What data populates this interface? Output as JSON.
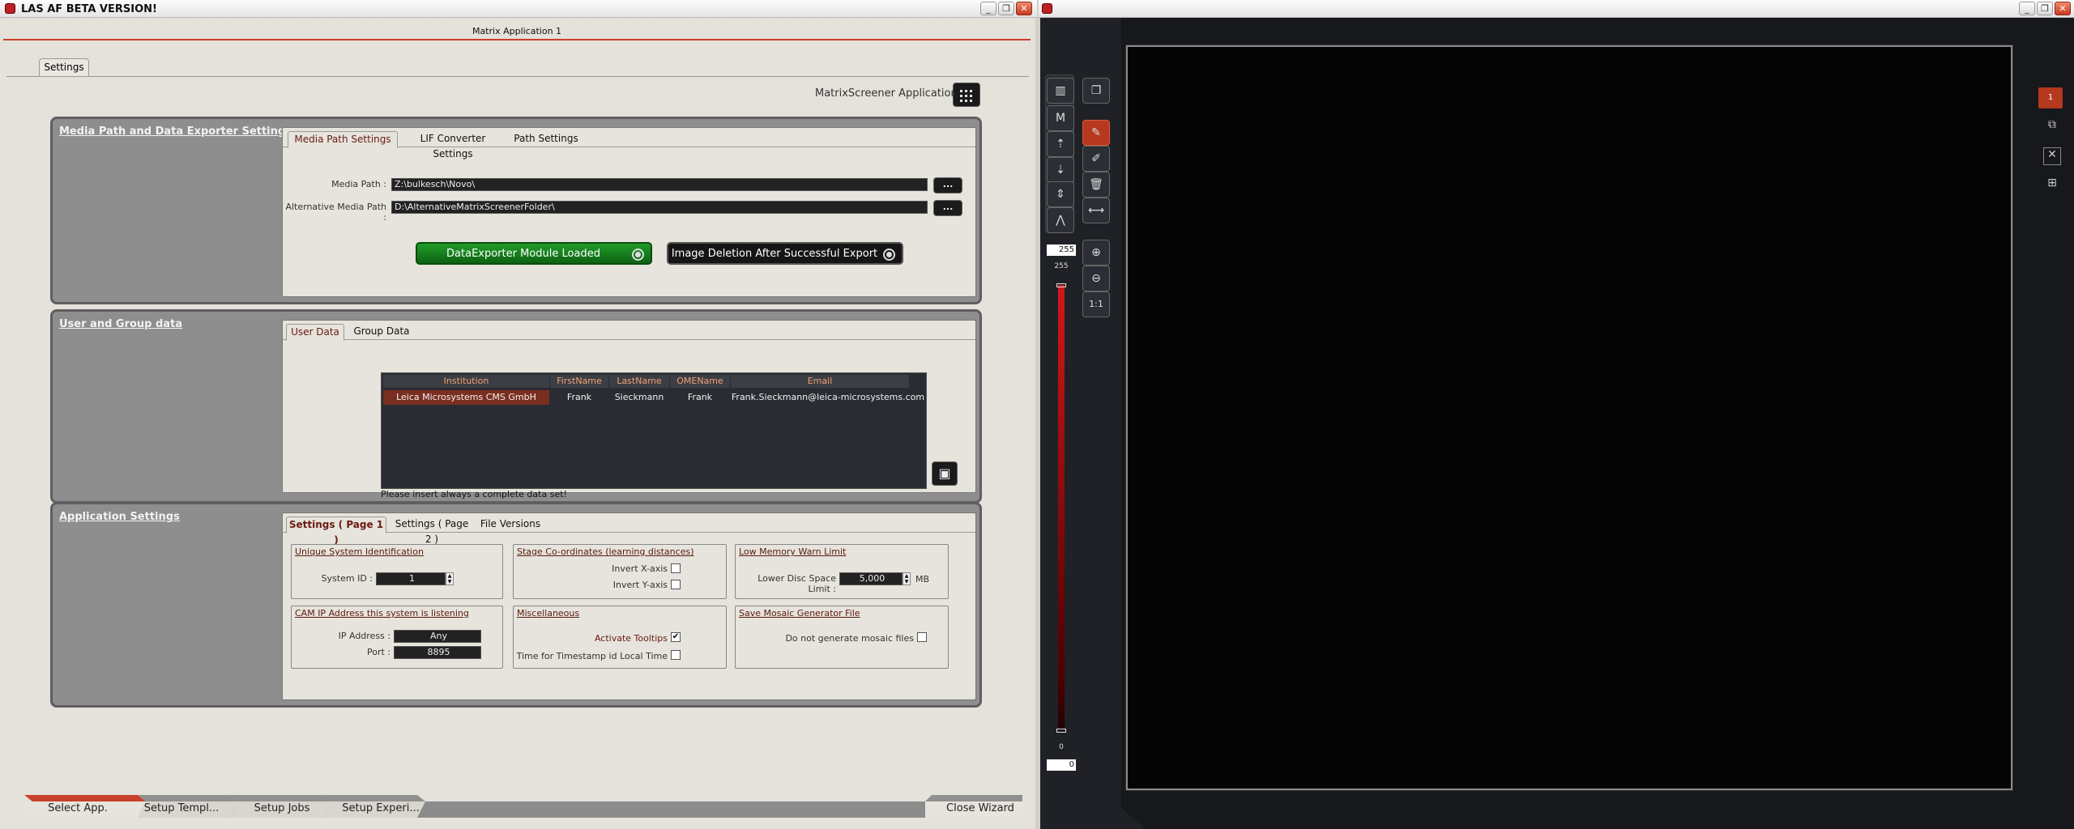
{
  "left_window": {
    "title": "LAS AF BETA VERSION!",
    "matrix_title": "Matrix Application 1",
    "outer_tab": "Settings",
    "matrixscreener_label": "MatrixScreener Applications"
  },
  "media": {
    "title": "Media Path and Data Exporter Settings",
    "tabs": [
      "Media Path Settings",
      "LIF Converter Settings",
      "Path Settings"
    ],
    "media_path_label": "Media Path",
    "media_path_value": "Z:\\bulkesch\\Novo\\",
    "alt_path_label": "Alternative Media Path",
    "alt_path_value": "D:\\AlternativeMatrixScreenerFolder\\",
    "browse": "...",
    "exporter_button": "DataExporter Module Loaded",
    "deletion_button": "Image Deletion After Successful Export"
  },
  "user": {
    "title": "User and Group data",
    "tabs": [
      "User Data",
      "Group Data"
    ],
    "columns": [
      "Institution",
      "FirstName",
      "LastName",
      "OMEName",
      "Email"
    ],
    "rows": [
      [
        "Leica Microsystems CMS GmbH",
        "Frank",
        "Sieckmann",
        "Frank",
        "Frank.Sieckmann@leica-microsystems.com"
      ]
    ],
    "hint": "Please insert always a complete data set!"
  },
  "app": {
    "title": "Application Settings",
    "tabs": [
      "Settings ( Page 1 )",
      "Settings ( Page 2 )",
      "File Versions"
    ],
    "usi_title": "Unique System Identification",
    "system_id_label": "System ID",
    "system_id": "1",
    "stage_title": "Stage Co-ordinates (learning distances)",
    "invert_x": "Invert X-axis",
    "invert_y": "Invert Y-axis",
    "lowmem_title": "Low Memory Warn Limit",
    "lowdisc_label": "Lower Disc Space Limit",
    "lowdisc_value": "5,000",
    "lowdisc_unit": "MB",
    "cam_title": "CAM IP Address this system is listening",
    "ip_label": "IP Address",
    "ip_value": "Any",
    "port_label": "Port",
    "port_value": "8895",
    "misc_title": "Miscellaneous",
    "tooltips_label": "Activate Tooltips",
    "timestamp_label": "Time for Timestamp id Local Time",
    "mosaic_title": "Save Mosaic Generator File",
    "mosaic_label": "Do not generate mosaic files"
  },
  "wizard": {
    "steps": [
      "Select App.",
      "Setup Templ...",
      "Setup Jobs",
      "Setup Experi..."
    ],
    "close": "Close Wizard"
  },
  "viewer": {
    "top_value": "255",
    "top_label": "255",
    "bottom_label": "0",
    "bottom_value": "0",
    "page_badge": "1",
    "zoom_reset": "1:1"
  },
  "colors": {
    "accent": "#c9412a",
    "panel": "#8e8e8e",
    "table_header_text": "#f1a074",
    "viewer_bg": "#050404"
  }
}
